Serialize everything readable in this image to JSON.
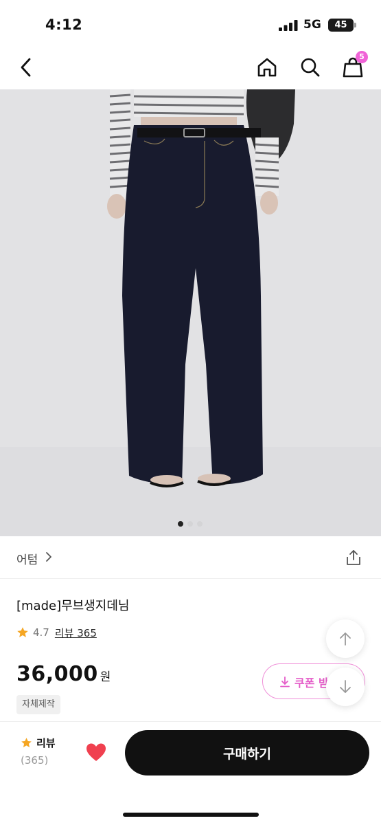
{
  "status_bar": {
    "time": "4:12",
    "network": "5G",
    "battery": "45"
  },
  "nav": {
    "back_icon": "chevron-left-icon",
    "home_icon": "home-icon",
    "search_icon": "search-icon",
    "bag_icon": "shopping-bag-icon",
    "cart_count": "5"
  },
  "gallery": {
    "image_count": 3,
    "active_index": 0
  },
  "brand": {
    "name": "어텀"
  },
  "product": {
    "name": "[made]무브생지데님",
    "rating": "4.7",
    "review_link": "리뷰 365",
    "price": "36,000",
    "currency": "원",
    "tag": "자체제작",
    "coupon_label": "쿠폰 받"
  },
  "bottom_bar": {
    "review_label": "리뷰",
    "review_count": "(365)",
    "buy_label": "구매하기"
  },
  "colors": {
    "accent_pink": "#e45bc8",
    "badge_pink": "#f063d7",
    "star": "#f5a623",
    "heart": "#f0404f",
    "buy_button": "#111111"
  }
}
